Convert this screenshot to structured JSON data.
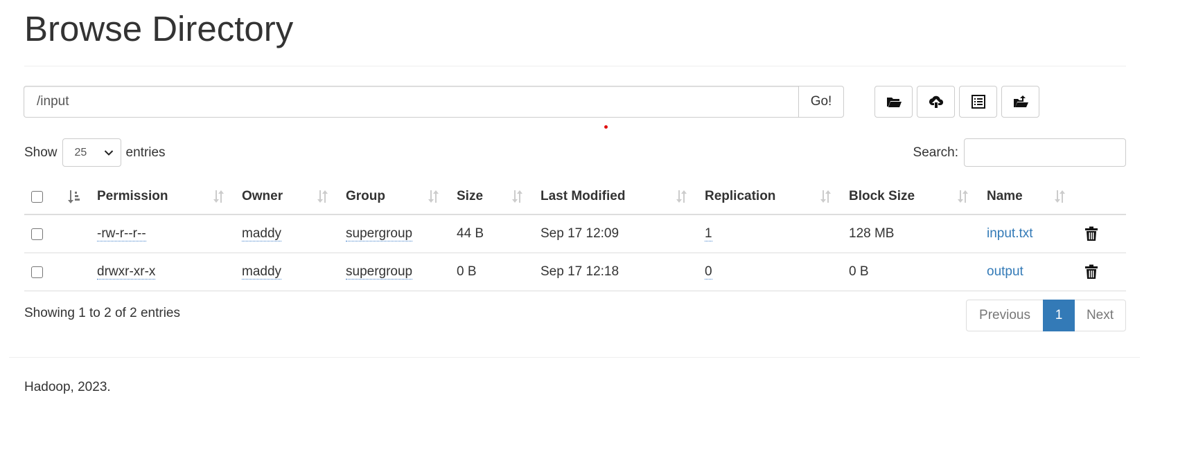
{
  "page": {
    "title": "Browse Directory"
  },
  "path_bar": {
    "value": "/input",
    "go_label": "Go!"
  },
  "toolbar": {
    "buttons": [
      {
        "icon": "folder-open-icon"
      },
      {
        "icon": "cloud-upload-icon"
      },
      {
        "icon": "list-alt-icon"
      },
      {
        "icon": "folder-move-icon"
      }
    ]
  },
  "entries": {
    "show_label": "Show",
    "page_size": "25",
    "entries_label": "entries",
    "search_label": "Search:",
    "search_value": ""
  },
  "table": {
    "columns": [
      "Permission",
      "Owner",
      "Group",
      "Size",
      "Last Modified",
      "Replication",
      "Block Size",
      "Name"
    ],
    "rows": [
      {
        "permission": "-rw-r--r--",
        "owner": "maddy",
        "group": "supergroup",
        "size": "44 B",
        "last_modified": "Sep 17 12:09",
        "replication": "1",
        "block_size": "128 MB",
        "name": "input.txt"
      },
      {
        "permission": "drwxr-xr-x",
        "owner": "maddy",
        "group": "supergroup",
        "size": "0 B",
        "last_modified": "Sep 17 12:18",
        "replication": "0",
        "block_size": "0 B",
        "name": "output"
      }
    ]
  },
  "summary": {
    "info": "Showing 1 to 2 of 2 entries"
  },
  "pagination": {
    "previous": "Previous",
    "current": "1",
    "next": "Next"
  },
  "footer": {
    "text": "Hadoop, 2023."
  },
  "colors": {
    "link": "#337ab7",
    "active_page": "#337ab7",
    "marker": "#e01010"
  }
}
